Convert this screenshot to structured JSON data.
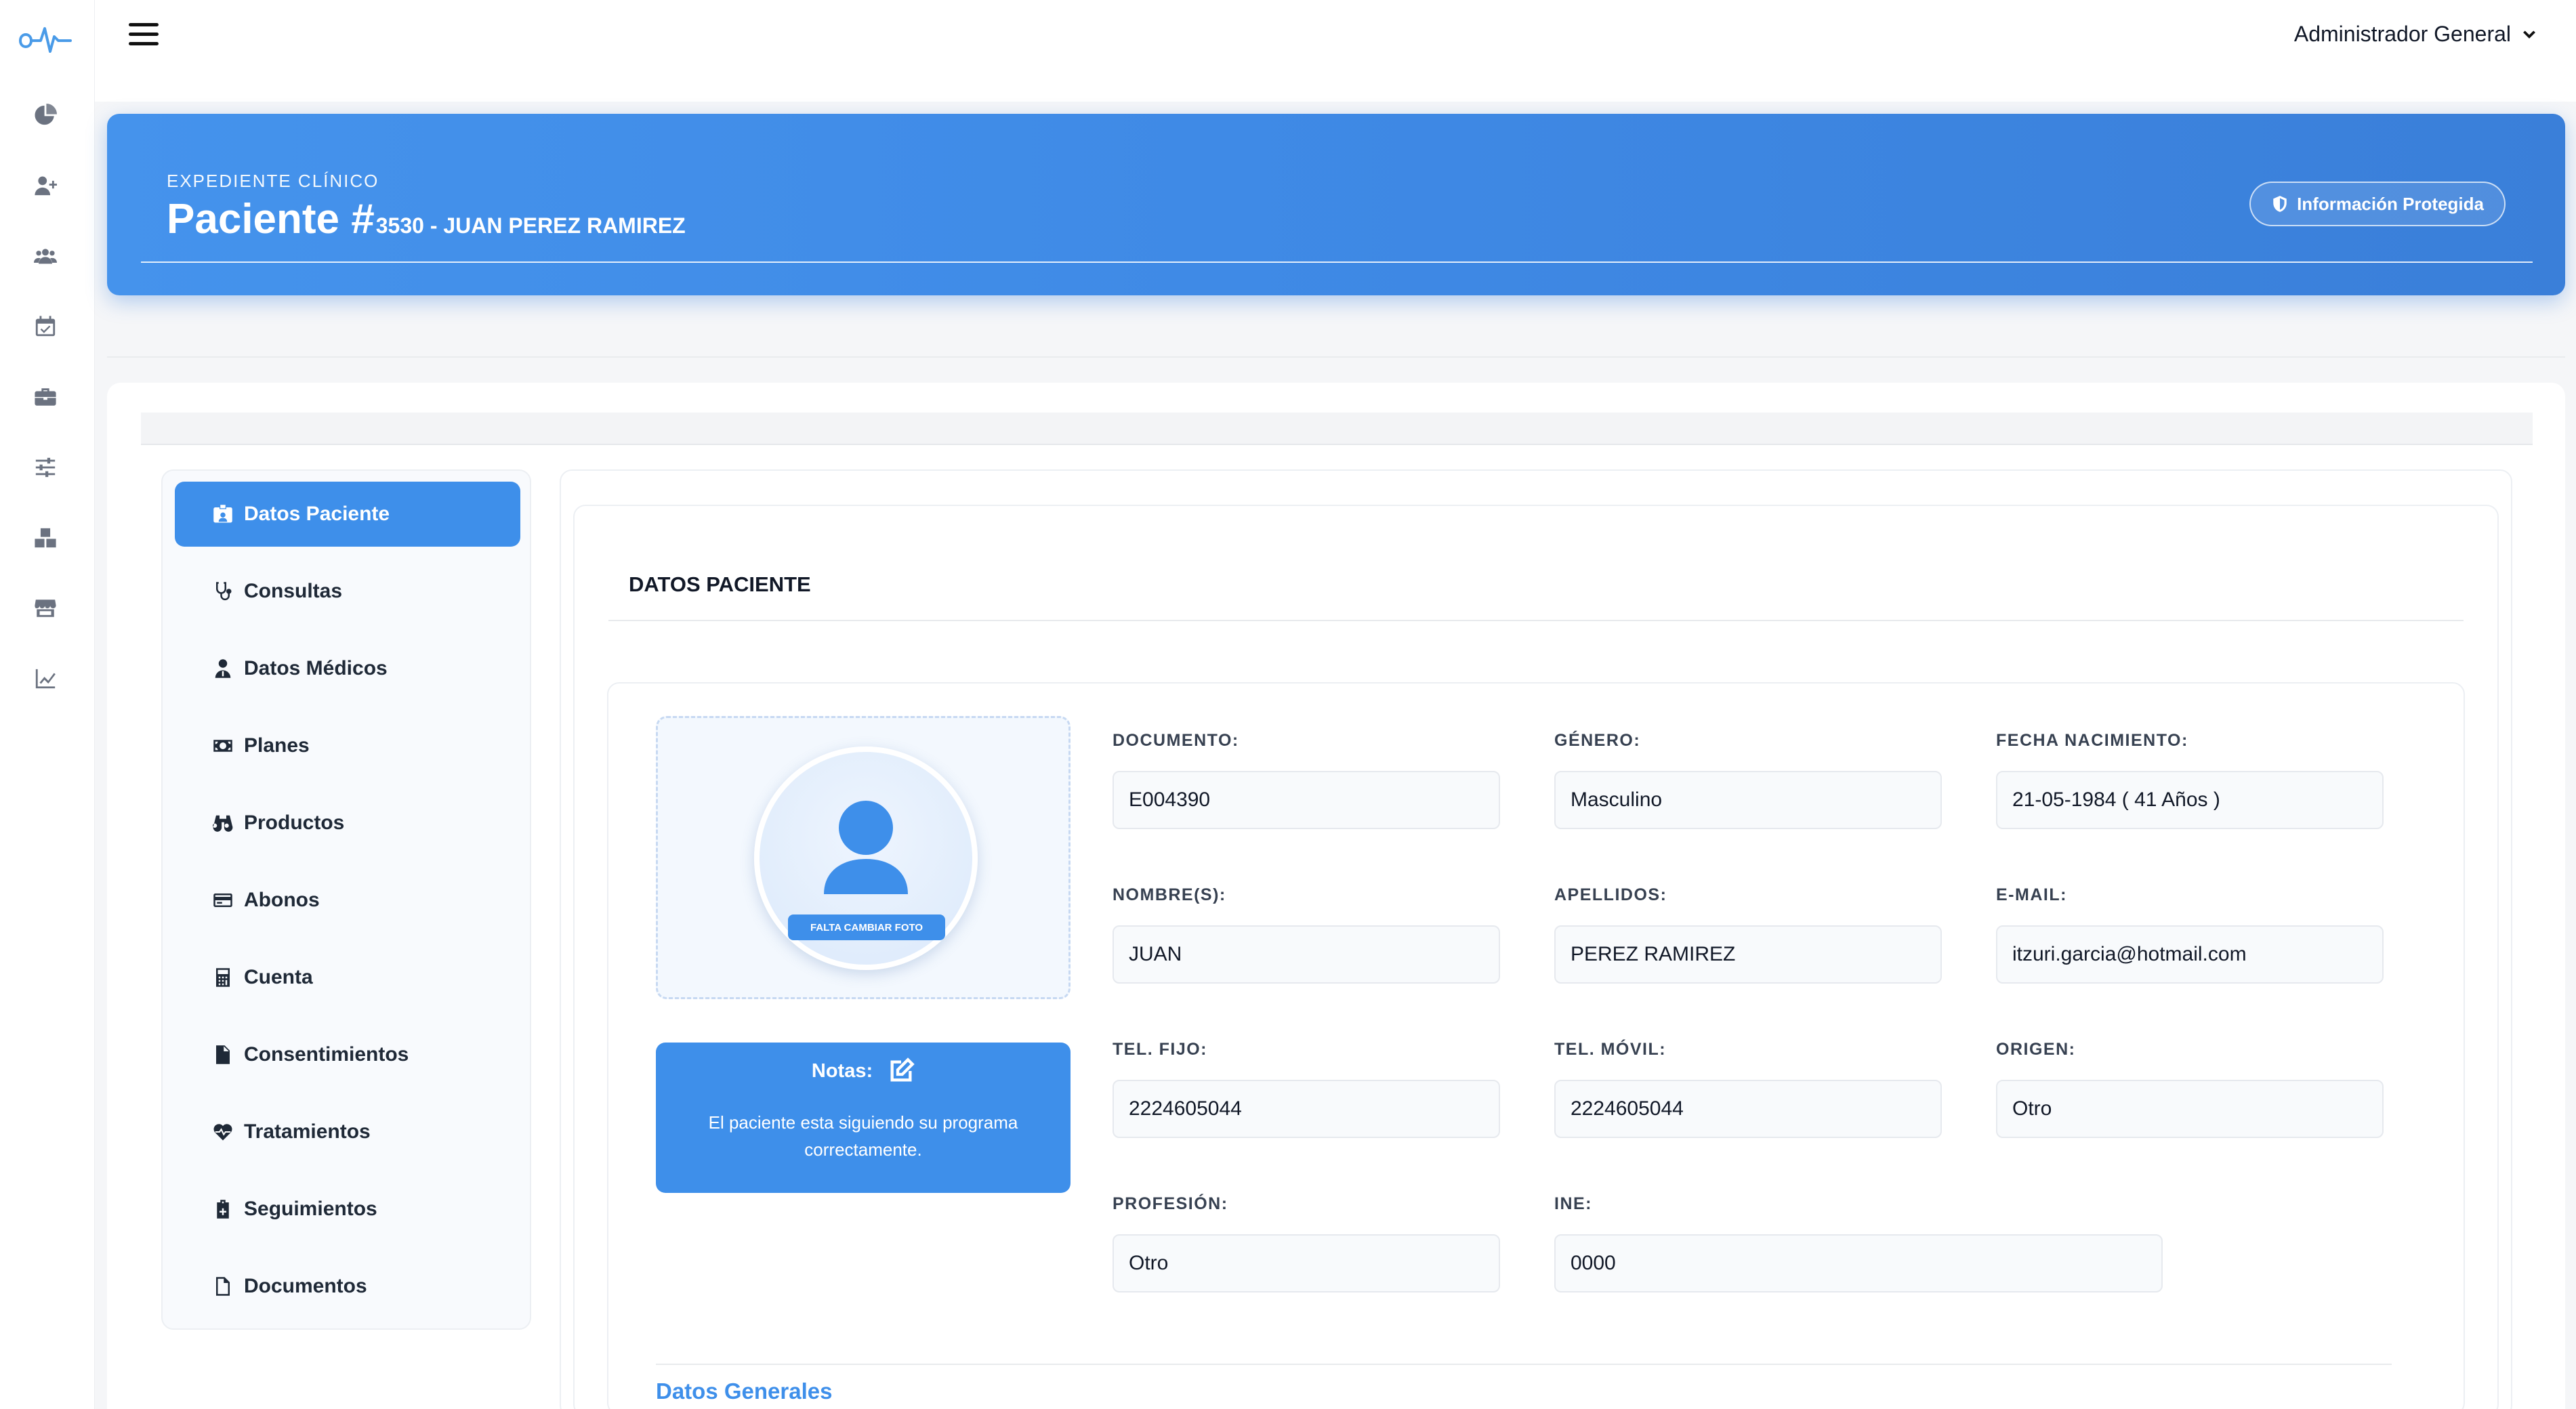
{
  "topbar": {
    "user_name": "Administrador General"
  },
  "hero": {
    "eyebrow": "EXPEDIENTE CLÍNICO",
    "title_main": "Paciente #",
    "title_sub": "3530 - JUAN PEREZ RAMIREZ",
    "badge": "Información Protegida"
  },
  "rail": {
    "icons": [
      "dashboard-icon",
      "add-user-icon",
      "users-icon",
      "calendar-check-icon",
      "briefcase-icon",
      "sliders-icon",
      "boxes-icon",
      "store-icon",
      "chart-line-icon"
    ]
  },
  "nav": {
    "items": [
      {
        "label": "Datos Paciente",
        "icon": "id-card-icon",
        "active": true
      },
      {
        "label": "Consultas",
        "icon": "stethoscope-icon"
      },
      {
        "label": "Datos Médicos",
        "icon": "doctor-icon"
      },
      {
        "label": "Planes",
        "icon": "money-bill-icon"
      },
      {
        "label": "Productos",
        "icon": "binoculars-icon"
      },
      {
        "label": "Abonos",
        "icon": "credit-card-icon"
      },
      {
        "label": "Cuenta",
        "icon": "calculator-icon"
      },
      {
        "label": "Consentimientos",
        "icon": "file-icon"
      },
      {
        "label": "Tratamientos",
        "icon": "heart-pulse-icon"
      },
      {
        "label": "Seguimientos",
        "icon": "clipboard-icon"
      },
      {
        "label": "Documentos",
        "icon": "file-outline-icon"
      }
    ]
  },
  "section": {
    "title": "DATOS PACIENTE",
    "photo_tag": "FALTA CAMBIAR FOTO",
    "notes_title": "Notas:",
    "notes_text": "El paciente esta siguiendo su programa correctamente.",
    "footer_title": "Datos Generales"
  },
  "fields": {
    "documento": {
      "label": "DOCUMENTO:",
      "value": "E004390"
    },
    "genero": {
      "label": "GÉNERO:",
      "value": "Masculino"
    },
    "fecha": {
      "label": "FECHA NACIMIENTO:",
      "value": "21-05-1984 ( 41 Años )"
    },
    "nombre": {
      "label": "NOMBRE(S):",
      "value": "JUAN"
    },
    "apellidos": {
      "label": "APELLIDOS:",
      "value": "PEREZ RAMIREZ"
    },
    "email": {
      "label": "E-MAIL:",
      "value": "itzuri.garcia@hotmail.com"
    },
    "tel_fijo": {
      "label": "TEL. FIJO:",
      "value": "2224605044"
    },
    "tel_movil": {
      "label": "TEL. MÓVIL:",
      "value": "2224605044"
    },
    "origen": {
      "label": "ORIGEN:",
      "value": "Otro"
    },
    "profesion": {
      "label": "PROFESIÓN:",
      "value": "Otro"
    },
    "ine": {
      "label": "INE:",
      "value": "0000"
    }
  },
  "colors": {
    "primary": "#3e8fea",
    "hero_start": "#4593ec",
    "hero_end": "#3a7fd9"
  }
}
